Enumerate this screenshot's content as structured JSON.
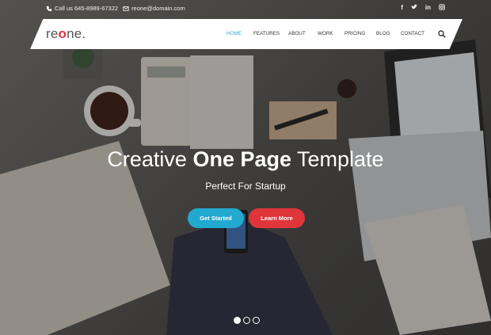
{
  "topbar": {
    "phone": "Call us 645-8989-67322",
    "email": "reone@domain.com",
    "social": [
      "facebook-icon",
      "twitter-icon",
      "linkedin-icon",
      "instagram-icon"
    ]
  },
  "nav": {
    "logo_prefix": "re",
    "logo_o": "o",
    "logo_suffix": "ne.",
    "items": [
      "HOME",
      "FEATURES",
      "ABOUT",
      "WORK",
      "PRICING",
      "BLOG",
      "CONTACT"
    ],
    "active": "HOME"
  },
  "hero": {
    "title_light_1": "Creative ",
    "title_bold": "One Page",
    "title_light_2": " Template",
    "subtitle": "Perfect For Startup",
    "btn_start": "Get Started",
    "btn_more": "Learn More",
    "slides_total": 3,
    "slide_active": 1
  },
  "colors": {
    "accent_blue": "#22a9cf",
    "accent_red": "#e0353a",
    "logo_red": "#e0323f",
    "active_link": "#2aa8d4"
  }
}
